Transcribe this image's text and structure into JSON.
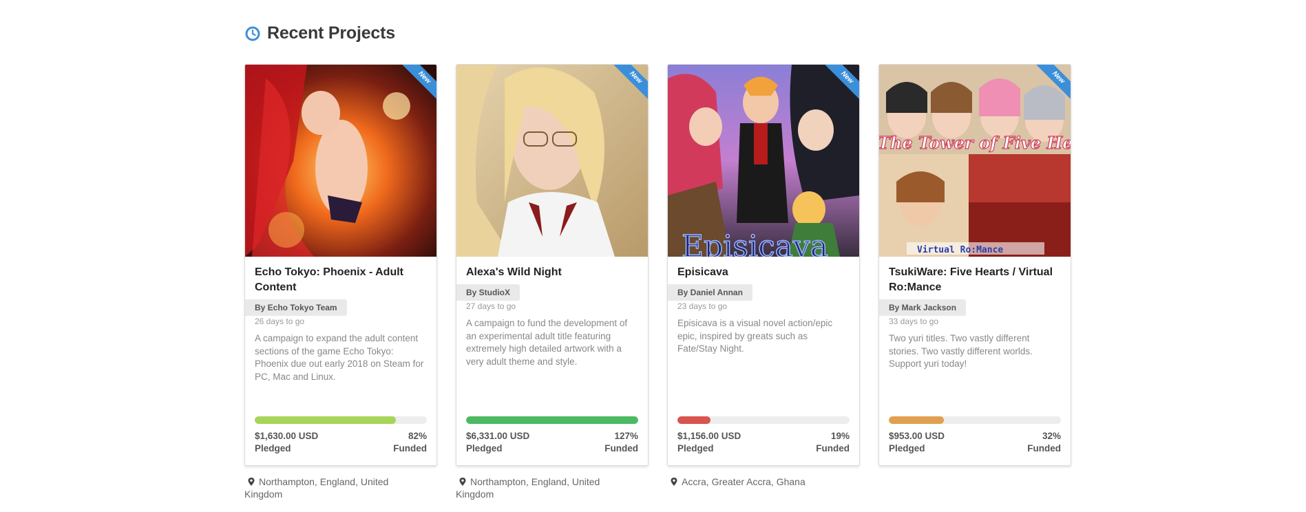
{
  "section": {
    "title": "Recent Projects",
    "icon": "clock-icon",
    "accent": "#3b8fd9"
  },
  "projects": [
    {
      "title": "Echo Tokyo: Phoenix - Adult Content",
      "badge": "New",
      "author": "By Echo Tokyo Team",
      "days": "26 days to go",
      "description": "A campaign to expand the adult content sections of the game Echo Tokyo: Phoenix due out early 2018 on Steam for PC, Mac and Linux.",
      "pledged_amount": "$1,630.00 USD",
      "pledged_label": "Pledged",
      "funded_percent": "82%",
      "funded_label": "Funded",
      "progress": 0.82,
      "progress_color": "#a8d45a",
      "location": "Northampton, England, United Kingdom"
    },
    {
      "title": "Alexa's Wild Night",
      "badge": "New",
      "author": "By StudioX",
      "days": "27 days to go",
      "description": "A campaign to fund the development of an experimental adult title featuring extremely high detailed artwork with a very adult theme and style.",
      "pledged_amount": "$6,331.00 USD",
      "pledged_label": "Pledged",
      "funded_percent": "127%",
      "funded_label": "Funded",
      "progress": 1.0,
      "progress_color": "#4dba62",
      "location": "Northampton, England, United Kingdom"
    },
    {
      "title": "Episicava",
      "badge": "New",
      "author": "By Daniel Annan",
      "days": "23 days to go",
      "description": "Episicava is a visual novel action/epic epic, inspired by greats such as Fate/Stay Night.",
      "pledged_amount": "$1,156.00 USD",
      "pledged_label": "Pledged",
      "funded_percent": "19%",
      "funded_label": "Funded",
      "progress": 0.19,
      "progress_color": "#d9534f",
      "location": "Accra, Greater Accra, Ghana"
    },
    {
      "title": "TsukiWare: Five Hearts / Virtual Ro:Mance",
      "badge": "New",
      "author": "By Mark Jackson",
      "days": "33 days to go",
      "description": "Two yuri titles. Two vastly different stories. Two vastly different worlds. Support yuri today!",
      "pledged_amount": "$953.00 USD",
      "pledged_label": "Pledged",
      "funded_percent": "32%",
      "funded_label": "Funded",
      "progress": 0.32,
      "progress_color": "#e0a050",
      "location": ""
    }
  ]
}
